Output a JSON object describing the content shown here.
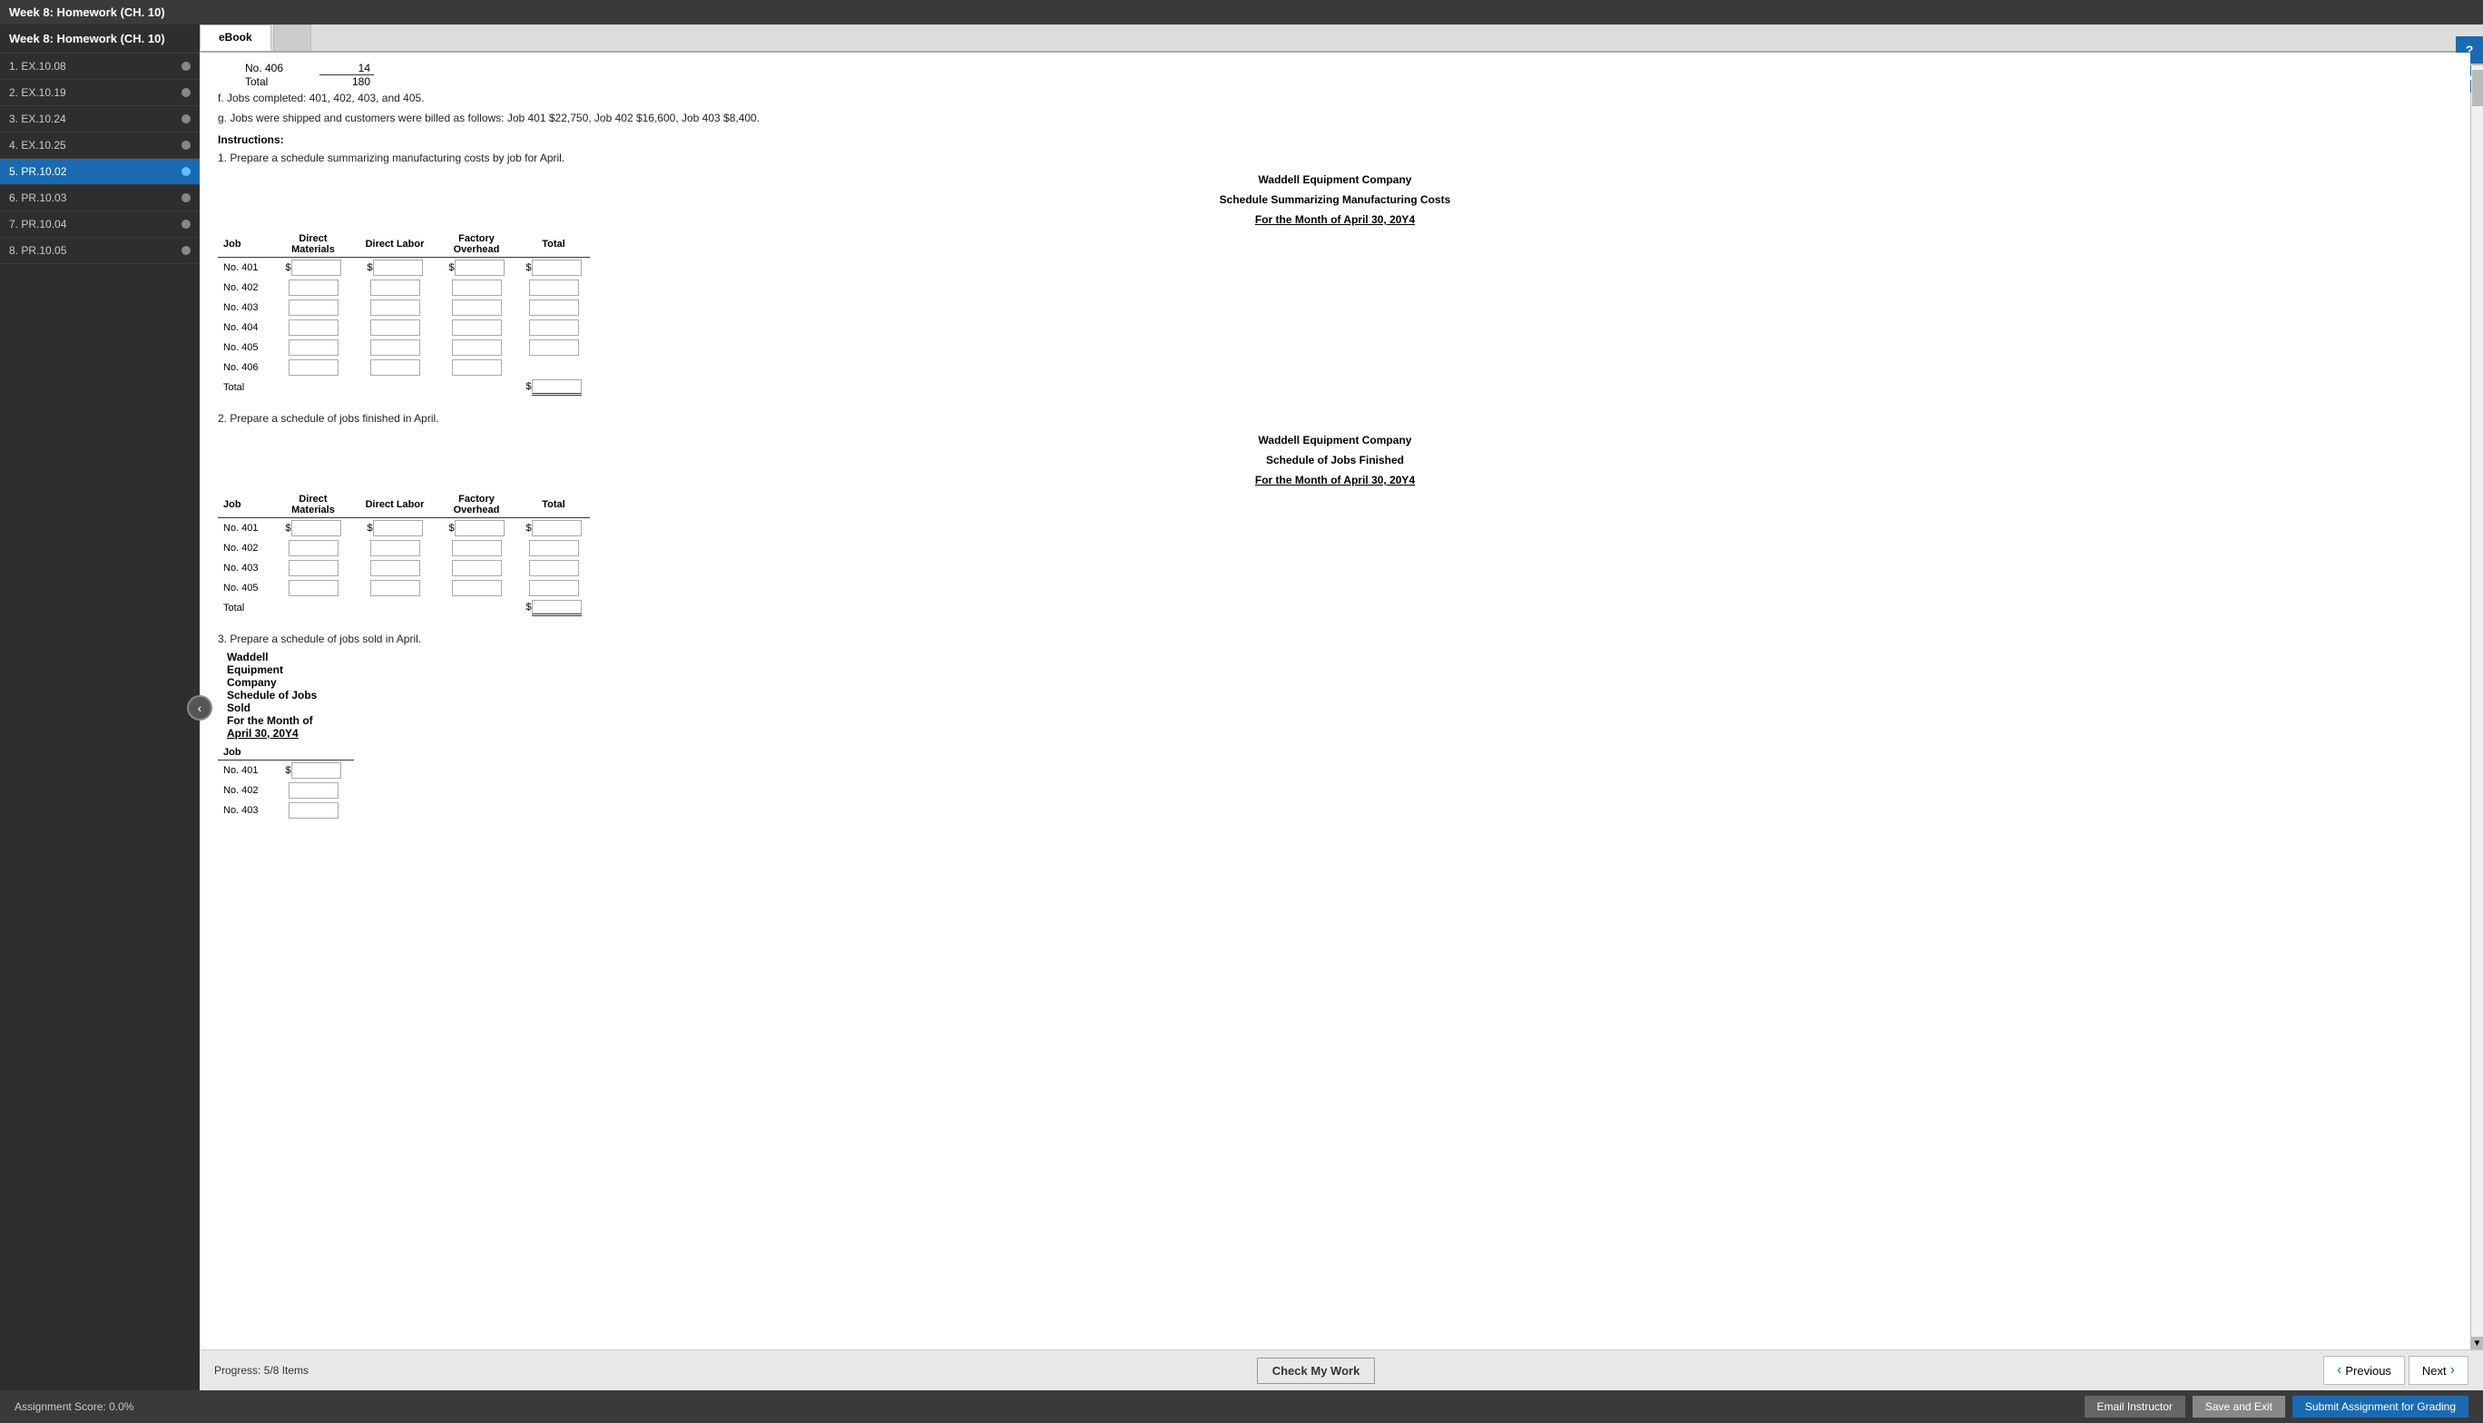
{
  "app": {
    "title": "Week 8: Homework (CH. 10)"
  },
  "tabs": [
    {
      "label": "eBook",
      "active": true
    },
    {
      "label": "",
      "active": false
    }
  ],
  "sidebar": {
    "items": [
      {
        "id": "1",
        "label": "1. EX.10.08",
        "active": false
      },
      {
        "id": "2",
        "label": "2. EX.10.19",
        "active": false
      },
      {
        "id": "3",
        "label": "3. EX.10.24",
        "active": false
      },
      {
        "id": "4",
        "label": "4. EX.10.25",
        "active": false
      },
      {
        "id": "5",
        "label": "5. PR.10.02",
        "active": true
      },
      {
        "id": "6",
        "label": "6. PR.10.03",
        "active": false
      },
      {
        "id": "7",
        "label": "7. PR.10.04",
        "active": false
      },
      {
        "id": "8",
        "label": "8. PR.10.05",
        "active": false
      }
    ]
  },
  "content": {
    "intro_lines": [
      "No. 406    14",
      "Total    180"
    ],
    "notes": [
      "f. Jobs completed: 401, 402, 403, and 405.",
      "g. Jobs were shipped and customers were billed as follows: Job 401 $22,750, Job 402 $16,600, Job 403 $8,400."
    ],
    "instructions_header": "Instructions:",
    "instruction1": "1. Prepare a schedule summarizing manufacturing costs by job for April.",
    "table1_company": "Waddell Equipment Company",
    "table1_subtitle": "Schedule Summarizing Manufacturing Costs",
    "table1_period": "For the Month of April 30, 20Y4",
    "table1_headers": [
      "Job",
      "Direct Materials",
      "Direct Labor",
      "Factory Overhead",
      "Total"
    ],
    "table1_rows": [
      "No. 401",
      "No. 402",
      "No. 403",
      "No. 404",
      "No. 405",
      "No. 406"
    ],
    "table1_total": "Total",
    "instruction2": "2. Prepare a schedule of jobs finished in April.",
    "table2_company": "Waddell Equipment Company",
    "table2_subtitle": "Schedule of Jobs Finished",
    "table2_period": "For the Month of April 30, 20Y4",
    "table2_headers": [
      "Job",
      "Direct Materials",
      "Direct Labor",
      "Factory Overhead",
      "Total"
    ],
    "table2_rows": [
      "No. 401",
      "No. 402",
      "No. 403",
      "No. 405"
    ],
    "table2_total": "Total",
    "instruction3": "3. Prepare a schedule of jobs sold in April.",
    "table3_company": "Waddell Equipment Company",
    "table3_subtitle": "Schedule of Jobs Sold",
    "table3_period": "For the Month of April 30, 20Y4",
    "table3_col": "Job",
    "table3_rows": [
      "No. 401",
      "No. 402",
      "No. 403"
    ]
  },
  "bottom_nav": {
    "progress_label": "Progress:",
    "progress_value": "5/8 Items",
    "check_work": "Check My Work",
    "previous": "Previous",
    "next": "Next"
  },
  "footer": {
    "score_label": "Assignment Score:",
    "score_value": "0.0%",
    "email_instructor": "Email Instructor",
    "save_exit": "Save and Exit",
    "submit": "Submit Assignment for Grading"
  },
  "help": {
    "icon1": "?",
    "icon2": "?"
  }
}
